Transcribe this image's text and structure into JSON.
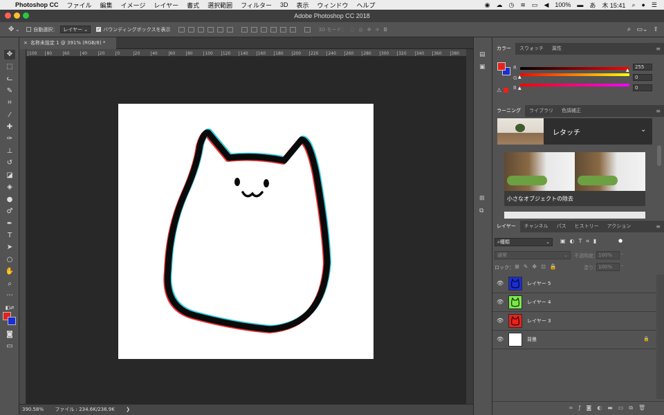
{
  "menubar": {
    "app_name": "Photoshop CC",
    "items": [
      "ファイル",
      "編集",
      "イメージ",
      "レイヤー",
      "書式",
      "選択範囲",
      "フィルター",
      "3D",
      "表示",
      "ウィンドウ",
      "ヘルプ"
    ],
    "battery": "100%",
    "input_method": "あ",
    "clock": "木 15:41"
  },
  "window": {
    "title": "Adobe Photoshop CC 2018"
  },
  "options_bar": {
    "auto_select_label": "自動選択：",
    "auto_select_value": "レイヤー",
    "bounding_box_label": "バウンディングボックスを表示",
    "mode_3d_label": "3D モード："
  },
  "document": {
    "tab_label": "名称未設定 1 @ 391% (RGB/8) *",
    "close_glyph": "×",
    "ruler_ticks": [
      "100",
      "80",
      "60",
      "40",
      "20",
      "0",
      "20",
      "40",
      "60",
      "80",
      "100",
      "120",
      "140",
      "160",
      "180",
      "200",
      "220",
      "240",
      "260",
      "280",
      "300",
      "320",
      "340",
      "360",
      "380"
    ]
  },
  "status": {
    "zoom": "390.58%",
    "file_info": "ファイル : 234.6K/236.9K",
    "arrow": "❯"
  },
  "color_panel": {
    "tabs": [
      "カラー",
      "スウォッチ",
      "属性"
    ],
    "channels": [
      {
        "label": "R",
        "value": "255"
      },
      {
        "label": "G",
        "value": "0"
      },
      {
        "label": "B",
        "value": "0"
      }
    ],
    "foreground": "#e8221b",
    "background": "#1a2dd6"
  },
  "learn_panel": {
    "tabs": [
      "ラーニング",
      "ライブラリ",
      "色調補正"
    ],
    "header_title": "レタッチ",
    "card_title": "小さなオブジェクトの除去"
  },
  "layers_panel": {
    "tabs": [
      "レイヤー",
      "チャンネル",
      "パス",
      "ヒストリー",
      "アクション"
    ],
    "filter_label": "種類",
    "blend_mode": "通常",
    "opacity_label": "不透明度：",
    "opacity_value": "100%",
    "lock_label": "ロック：",
    "fill_label": "塗り：",
    "fill_value": "100%",
    "layers": [
      {
        "name": "レイヤー 5",
        "color": "#1a2dd6"
      },
      {
        "name": "レイヤー 4",
        "color": "#7be84a"
      },
      {
        "name": "レイヤー 3",
        "color": "#e8221b"
      },
      {
        "name": "背景",
        "color": "#ffffff"
      }
    ]
  }
}
